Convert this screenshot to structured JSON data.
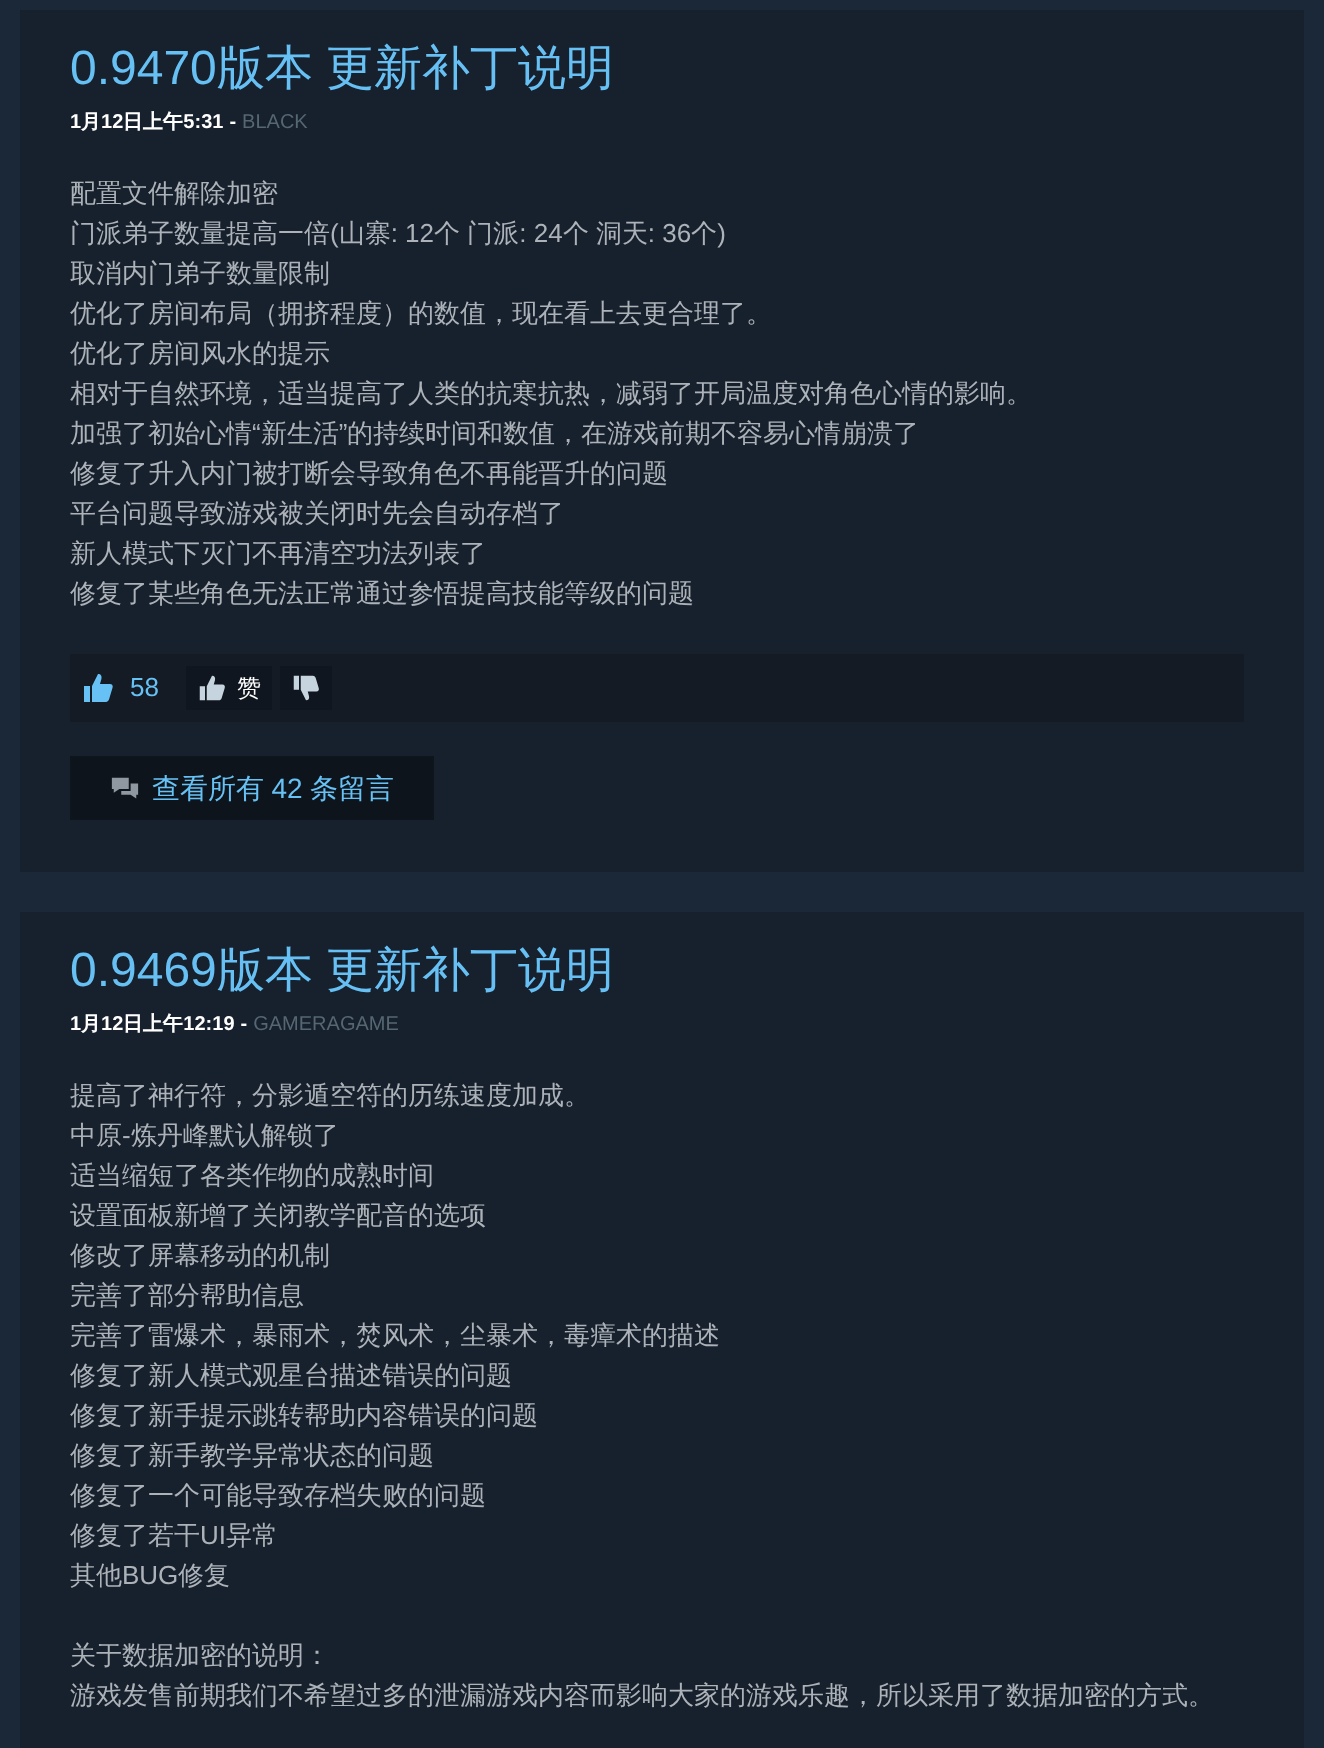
{
  "posts": [
    {
      "title": "0.9470版本 更新补丁说明",
      "date": "1月12日上午5:31",
      "separator": "-",
      "author": "BLACK",
      "paragraphs": [
        [
          "配置文件解除加密",
          "门派弟子数量提高一倍(山寨: 12个 门派: 24个 洞天: 36个)",
          "取消内门弟子数量限制",
          "优化了房间布局（拥挤程度）的数值，现在看上去更合理了。",
          "优化了房间风水的提示",
          "相对于自然环境，适当提高了人类的抗寒抗热，减弱了开局温度对角色心情的影响。",
          "加强了初始心情“新生活”的持续时间和数值，在游戏前期不容易心情崩溃了",
          "修复了升入内门被打断会导致角色不再能晋升的问题",
          "平台问题导致游戏被关闭时先会自动存档了",
          "新人模式下灭门不再清空功法列表了",
          "修复了某些角色无法正常通过参悟提高技能等级的问题"
        ]
      ],
      "rating": {
        "count": "58",
        "like_label": "赞"
      },
      "comments_button": "查看所有 42 条留言"
    },
    {
      "title": "0.9469版本 更新补丁说明",
      "date": "1月12日上午12:19",
      "separator": "-",
      "author": "GAMERAGAME",
      "paragraphs": [
        [
          "提高了神行符，分影遁空符的历练速度加成。",
          "中原-炼丹峰默认解锁了",
          "适当缩短了各类作物的成熟时间",
          "设置面板新增了关闭教学配音的选项",
          "修改了屏幕移动的机制",
          "完善了部分帮助信息",
          "完善了雷爆术，暴雨术，焚风术，尘暴术，毒瘴术的描述",
          "修复了新人模式观星台描述错误的问题",
          "修复了新手提示跳转帮助内容错误的问题",
          "修复了新手教学异常状态的问题",
          "修复了一个可能导致存档失败的问题",
          "修复了若干UI异常",
          "其他BUG修复"
        ],
        [
          "关于数据加密的说明：",
          "游戏发售前期我们不希望过多的泄漏游戏内容而影响大家的游戏乐趣，所以采用了数据加密的方式。"
        ]
      ]
    }
  ]
}
